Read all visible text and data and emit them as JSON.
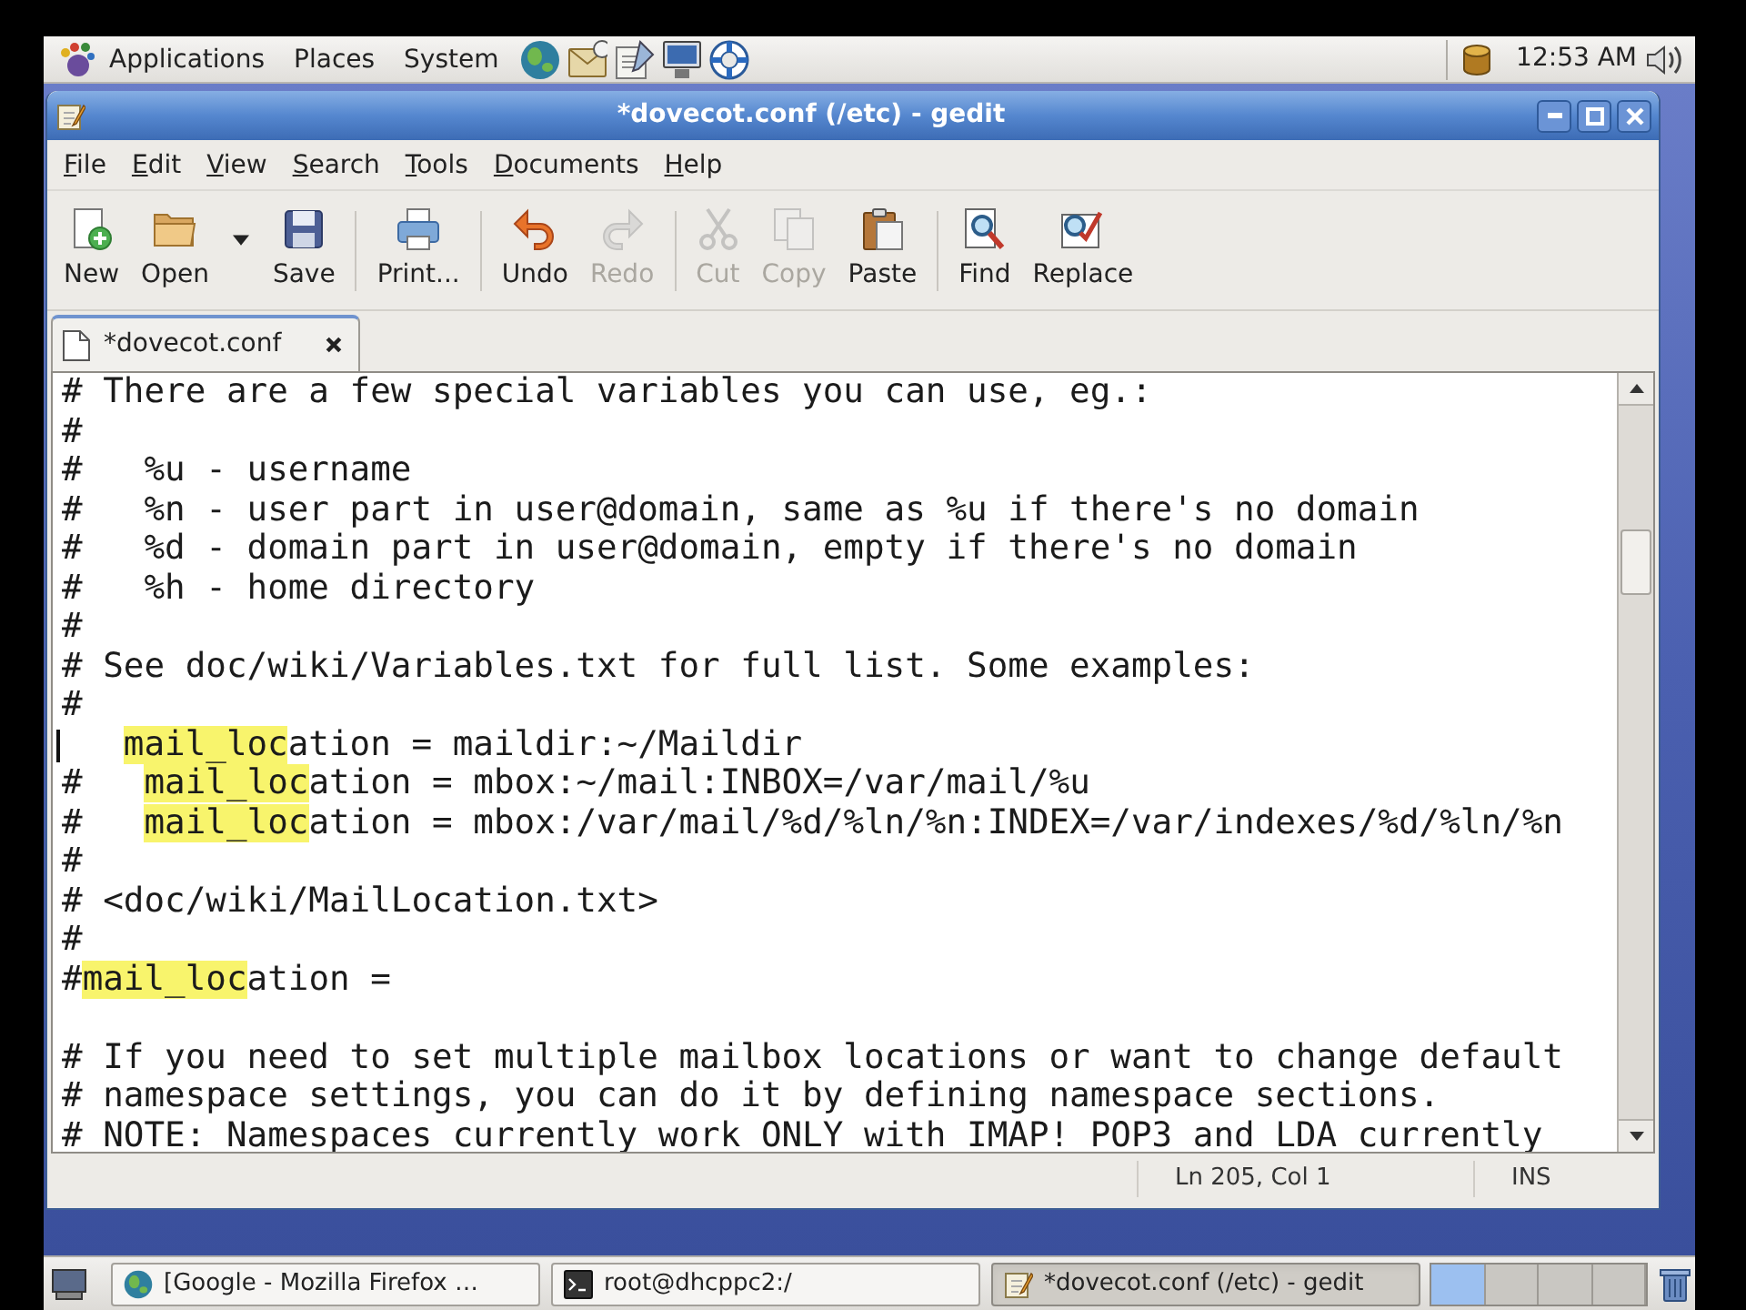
{
  "top_panel": {
    "menus": [
      "Applications",
      "Places",
      "System"
    ],
    "clock": "12:53 AM"
  },
  "window": {
    "title": "*dovecot.conf (/etc) - gedit"
  },
  "menu_bar": [
    "File",
    "Edit",
    "View",
    "Search",
    "Tools",
    "Documents",
    "Help"
  ],
  "toolbar": {
    "groups": [
      [
        {
          "label": "New",
          "disabled": false,
          "has_menu": false
        },
        {
          "label": "Open",
          "disabled": false,
          "has_menu": true
        },
        {
          "label": "Save",
          "disabled": false,
          "has_menu": false
        }
      ],
      [
        {
          "label": "Print...",
          "disabled": false,
          "has_menu": false
        }
      ],
      [
        {
          "label": "Undo",
          "disabled": false,
          "has_menu": false
        },
        {
          "label": "Redo",
          "disabled": true,
          "has_menu": false
        }
      ],
      [
        {
          "label": "Cut",
          "disabled": true,
          "has_menu": false
        },
        {
          "label": "Copy",
          "disabled": true,
          "has_menu": false
        },
        {
          "label": "Paste",
          "disabled": false,
          "has_menu": false
        }
      ],
      [
        {
          "label": "Find",
          "disabled": false,
          "has_menu": false
        },
        {
          "label": "Replace",
          "disabled": false,
          "has_menu": false
        }
      ]
    ]
  },
  "tabs": [
    {
      "label": "*dovecot.conf",
      "selected": true
    }
  ],
  "editor": {
    "lines": [
      {
        "text": "# There are a few special variables you can use, eg.:",
        "cursor": false
      },
      {
        "text": "#",
        "cursor": false
      },
      {
        "text": "#   %u - username",
        "cursor": false
      },
      {
        "text": "#   %n - user part in user@domain, same as %u if there's no domain",
        "cursor": false
      },
      {
        "text": "#   %d - domain part in user@domain, empty if there's no domain",
        "cursor": false
      },
      {
        "text": "#   %h - home directory",
        "cursor": false
      },
      {
        "text": "#",
        "cursor": false
      },
      {
        "text": "# See doc/wiki/Variables.txt for full list. Some examples:",
        "cursor": false
      },
      {
        "text": "#",
        "cursor": false
      },
      {
        "indented": true,
        "segments": [
          {
            "text": "mail_loc",
            "match": true
          },
          {
            "text": "ation = maildir:~/Maildir",
            "match": false
          }
        ],
        "cursor": true
      },
      {
        "segments": [
          {
            "text": "#   ",
            "match": false
          },
          {
            "text": "mail_loc",
            "match": true
          },
          {
            "text": "ation = mbox:~/mail:INBOX=/var/mail/%u",
            "match": false
          }
        ],
        "cursor": false
      },
      {
        "segments": [
          {
            "text": "#   ",
            "match": false
          },
          {
            "text": "mail_loc",
            "match": true
          },
          {
            "text": "ation = mbox:/var/mail/%d/%ln/%n:INDEX=/var/indexes/%d/%ln/%n",
            "match": false
          }
        ],
        "cursor": false
      },
      {
        "text": "#",
        "cursor": false
      },
      {
        "text": "# <doc/wiki/MailLocation.txt>",
        "cursor": false
      },
      {
        "text": "#",
        "cursor": false
      },
      {
        "segments": [
          {
            "text": "#",
            "match": false
          },
          {
            "text": "mail_loc",
            "match": true
          },
          {
            "text": "ation =",
            "match": false
          }
        ],
        "cursor": false
      },
      {
        "cursor": false
      },
      {
        "text": "# If you need to set multiple mailbox locations or want to change default",
        "cursor": false
      },
      {
        "text": "# namespace settings, you can do it by defining namespace sections.",
        "cursor": false
      },
      {
        "text": "# NOTE: Namespaces currently work ONLY with IMAP! POP3 and LDA currently",
        "cursor": false
      }
    ]
  },
  "status_bar": {
    "position": "Ln 205, Col 1",
    "mode": "INS"
  },
  "taskbar": {
    "windows": [
      {
        "label": "[Google - Mozilla Firefox …",
        "selected": false
      },
      {
        "label": "root@dhcppc2:/",
        "selected": false
      },
      {
        "label": "*dovecot.conf (/etc) - gedit",
        "selected": true
      }
    ],
    "workspaces": [
      {
        "selected": true
      },
      {
        "selected": false
      },
      {
        "selected": false
      },
      {
        "selected": false
      }
    ]
  }
}
